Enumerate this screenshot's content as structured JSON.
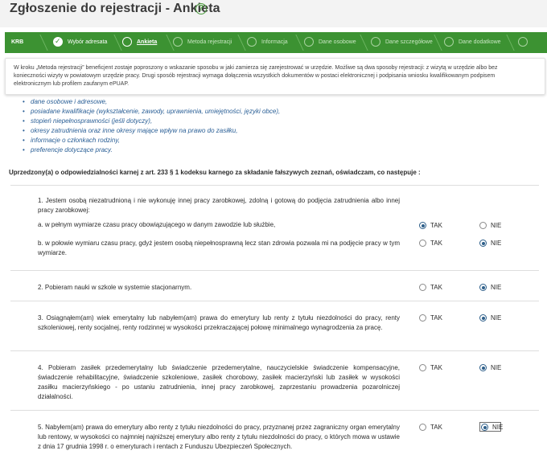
{
  "page": {
    "title": "Zgłoszenie do rejestracji - Ankieta",
    "help": "?"
  },
  "steps": [
    {
      "label": "KRB",
      "state": "brand"
    },
    {
      "label": "Wybór adresata",
      "state": "done"
    },
    {
      "label": "Ankieta",
      "state": "active"
    },
    {
      "label": "Metoda rejestracji",
      "state": "todo"
    },
    {
      "label": "Informacja",
      "state": "todo"
    },
    {
      "label": "Dane osobowe",
      "state": "todo"
    },
    {
      "label": "Dane szczegółowe",
      "state": "todo"
    },
    {
      "label": "Dane dodatkowe",
      "state": "todo"
    }
  ],
  "info": {
    "line1": "W kroku „Metoda rejestracji” beneficjent zostaje poproszony o wskazanie sposobu w jaki zamierza się zarejestrować w urzędzie. Możliwe są dwa sposoby rejestracji: z wizytą w urzędzie albo bez",
    "line2": "konieczności wizyty w powiatowym urzędzie pracy. Drugi sposób rejestracji wymaga dołączenia wszystkich dokumentów w postaci elektronicznej i podpisania wniosku kwalifikowanym podpisem",
    "line3": "elektronicznym lub profilem zaufanym ePUAP."
  },
  "bullets": [
    "dane osobowe i adresowe,",
    "posiadane kwalifikacje (wykształcenie, zawody, uprawnienia, umiejętności, języki obce),",
    "stopień niepełnosprawności (jeśli dotyczy),",
    "okresy zatrudnienia oraz inne okresy mające wpływ na prawo do zasiłku,",
    "informacje o członkach rodziny,",
    "preferencje dotyczące pracy."
  ],
  "declaration": "Uprzedzony(a) o odpowiedzialności karnej z art. 233 § 1 kodeksu karnego za składanie fałszywych zeznań, oświadczam, co następuje :",
  "options": {
    "yes": "TAK",
    "no": "NIE"
  },
  "questions": [
    {
      "text": "1. Jestem osobą niezatrudnioną i nie wykonuję innej pracy zarobkowej, zdolną i gotową do podjęcia zatrudnienia albo innej pracy zarobkowej:",
      "answer": null
    },
    {
      "text": "a. w pełnym wymiarze czasu pracy obowiązującego w danym zawodzie lub służbie,",
      "answer": "TAK"
    },
    {
      "text": "b. w połowie wymiaru czasu pracy, gdyż jestem osobą niepełnosprawną lecz stan zdrowia pozwala mi na podjęcie pracy w tym wymiarze.",
      "answer": "NIE"
    },
    {
      "text": "2. Pobieram nauki w szkole w systemie stacjonarnym.",
      "answer": "NIE"
    },
    {
      "text": "3. Osiągnąłem(am) wiek emerytalny lub nabyłem(am) prawa do emerytury lub renty z tytułu niezdolności do pracy, renty szkoleniowej, renty socjalnej, renty rodzinnej w wysokości przekraczającej połowę minimalnego wynagrodzenia za pracę.",
      "answer": "NIE"
    },
    {
      "text": "4. Pobieram zasiłek przedemerytalny lub świadczenie przedemerytalne, nauczycielskie świadczenie kompensacyjne, świadczenie rehabilitacyjne, świadczenie szkoleniowe, zasiłek chorobowy, zasiłek macierzyński lub zasiłek w wysokości zasiłku macierzyńskiego - po ustaniu zatrudnienia, innej pracy zarobkowej, zaprzestaniu prowadzenia pozarolniczej działalności.",
      "answer": "NIE"
    },
    {
      "text": "5. Nabyłem(am) prawa do emerytury albo renty z tytułu niezdolności do pracy, przyznanej przez zagraniczny organ emerytalny lub rentowy, w wysokości co najmniej najniższej emerytury albo renty z tytułu niezdolności do pracy, o których mowa w ustawie z dnia 17 grudnia 1998 r. o emeryturach i rentach z Funduszu Ubezpieczeń Społecznych.",
      "answer": "NIE"
    }
  ]
}
